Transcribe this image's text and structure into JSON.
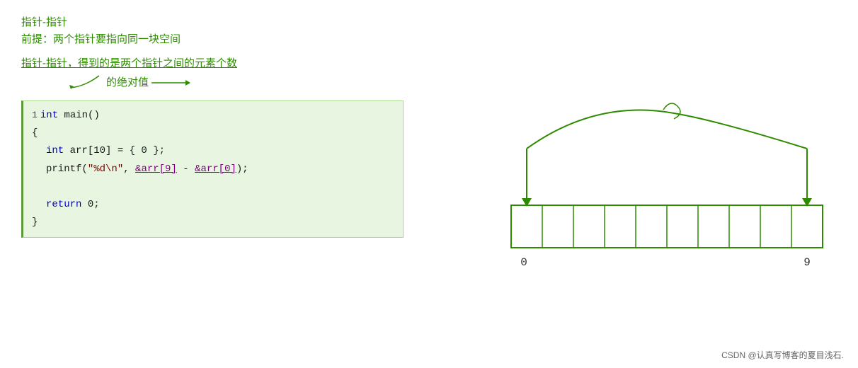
{
  "annotations": {
    "title1": "指针-指针",
    "title2": "前提：两个指针要指向同一块空间",
    "desc1": "指针-指针，得到的是两个指针之间的元素个数",
    "desc2": "的绝对值",
    "arrow_desc": "←"
  },
  "code": {
    "line1_marker": "1",
    "line1": "int main()",
    "line2": "{",
    "line3_indent": "    ",
    "line3": "int arr[10] = { 0 };",
    "line4_indent": "    ",
    "line4_func": "printf",
    "line4_str": "\"%d\\n\"",
    "line4_addr1": "&arr[9]",
    "line4_addr2": "&arr[0]",
    "line4_rest": ");",
    "line5_indent": "    ",
    "line5": "return 0;",
    "line6": "}"
  },
  "diagram": {
    "label0": "0",
    "label9": "9",
    "cells": 10
  },
  "watermark": "CSDN @认真写博客的夏目浅石."
}
